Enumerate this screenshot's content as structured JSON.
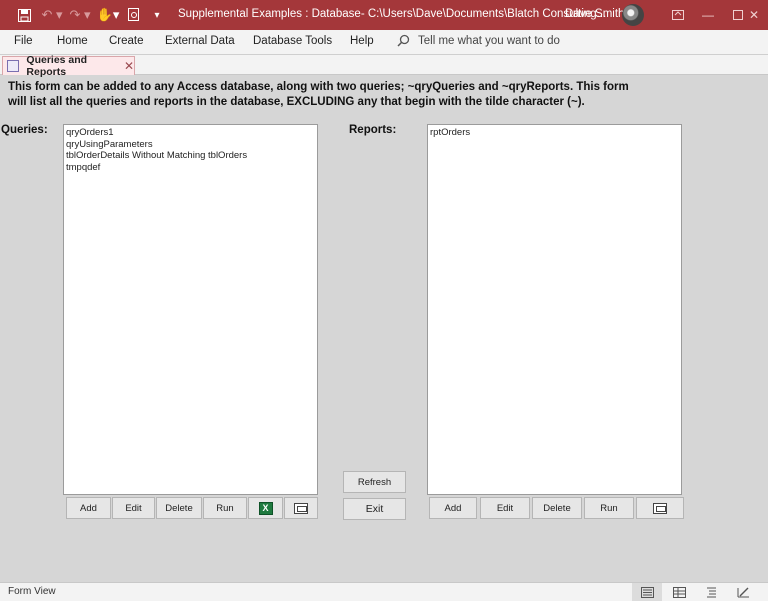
{
  "titlebar": {
    "title": "Supplemental Examples : Database- C:\\Users\\Dave\\Documents\\Blatch Consulting...",
    "user": "Dave Smith"
  },
  "menu": {
    "items": [
      "File",
      "Home",
      "Create",
      "External Data",
      "Database Tools",
      "Help"
    ],
    "tell_me": "Tell me what you want to do"
  },
  "doc_tab": {
    "label": "Queries and Reports"
  },
  "form": {
    "description": "This form can be added to any Access database, along with two queries; ~qryQueries and ~qryReports.  This form will list all the queries and reports in the database, EXCLUDING any that begin with the tilde character (~).",
    "queries_label": "Queries:",
    "reports_label": "Reports:",
    "queries": [
      "qryOrders1",
      "qryUsingParameters",
      "tblOrderDetails Without Matching tblOrders",
      "tmpqdef"
    ],
    "reports": [
      "rptOrders"
    ],
    "query_buttons": {
      "add": "Add",
      "edit": "Edit",
      "delete": "Delete",
      "run": "Run"
    },
    "report_buttons": {
      "add": "Add",
      "edit": "Edit",
      "delete": "Delete",
      "run": "Run"
    },
    "refresh": "Refresh",
    "exit": "Exit"
  },
  "status": {
    "text": "Form View"
  },
  "colors": {
    "titlebar": "#a4373a",
    "form_bg": "#d6d6d6",
    "excel_green": "#1f7a3f"
  }
}
